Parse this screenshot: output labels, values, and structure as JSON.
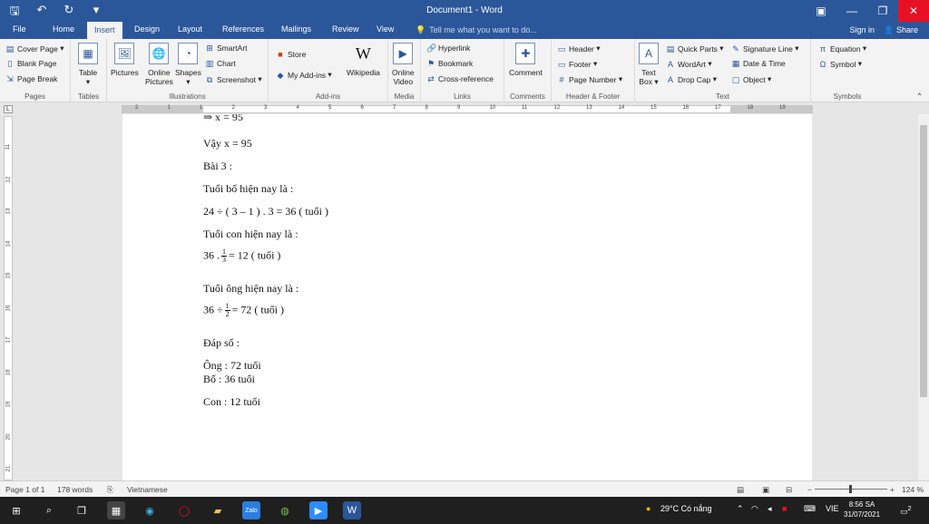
{
  "window": {
    "title": "Document1 - Word"
  },
  "tabs": [
    {
      "label": "File"
    },
    {
      "label": "Home"
    },
    {
      "label": "Insert"
    },
    {
      "label": "Design"
    },
    {
      "label": "Layout"
    },
    {
      "label": "References"
    },
    {
      "label": "Mailings"
    },
    {
      "label": "Review"
    },
    {
      "label": "View"
    }
  ],
  "tell_me": "Tell me what you want to do...",
  "account": {
    "signin": "Sign in",
    "share": "Share"
  },
  "ribbon": {
    "pages": {
      "label": "Pages",
      "cover": "Cover Page",
      "blank": "Blank Page",
      "break": "Page Break"
    },
    "tables": {
      "label": "Tables",
      "table": "Table"
    },
    "illustrations": {
      "label": "Illustrations",
      "pictures": "Pictures",
      "online1": "Online",
      "online2": "Pictures",
      "shapes": "Shapes",
      "smartart": "SmartArt",
      "chart": "Chart",
      "screenshot": "Screenshot"
    },
    "addins": {
      "label": "Add-ins",
      "store": "Store",
      "myaddins": "My Add-ins",
      "wikipedia": "Wikipedia"
    },
    "media": {
      "label": "Media",
      "video1": "Online",
      "video2": "Video"
    },
    "links": {
      "label": "Links",
      "hyperlink": "Hyperlink",
      "bookmark": "Bookmark",
      "crossref": "Cross-reference"
    },
    "comments": {
      "label": "Comments",
      "comment": "Comment"
    },
    "headerfooter": {
      "label": "Header & Footer",
      "header": "Header",
      "footer": "Footer",
      "pagenumber": "Page Number"
    },
    "text": {
      "label": "Text",
      "textbox1": "Text",
      "textbox2": "Box",
      "quickparts": "Quick Parts",
      "wordart": "WordArt",
      "dropcap": "Drop Cap",
      "signature": "Signature Line",
      "datetime": "Date & Time",
      "object": "Object"
    },
    "symbols": {
      "label": "Symbols",
      "equation": "Equation",
      "symbol": "Symbol"
    }
  },
  "document": {
    "lines": {
      "l0": "⇒ x = 95",
      "l1": "Vậy x = 95",
      "l2": "Bài 3 :",
      "l3": "Tuổi bố hiện nay là :",
      "l4": "24 ÷ ( 3 – 1 ) . 3 = 36 ( tuổi )",
      "l5": "Tuổi con hiện nay là :",
      "l6a": "36 .",
      "l6n": "1",
      "l6d": "3",
      "l6b": "= 12 ( tuổi )",
      "l7": "Tuổi ông hiện nay là :",
      "l8a": "36 ÷",
      "l8n": "1",
      "l8d": "2",
      "l8b": "= 72 ( tuổi )",
      "l9": "Đáp số :",
      "l10": "Ông : 72 tuổi",
      "l11": "Bố : 36 tuổi",
      "l12": "Con : 12 tuổi"
    }
  },
  "ruler_numbers": [
    "2",
    "1",
    "1",
    "2",
    "3",
    "4",
    "5",
    "6",
    "7",
    "8",
    "9",
    "10",
    "11",
    "12",
    "13",
    "14",
    "15",
    "16",
    "17",
    "18",
    "19"
  ],
  "vruler_numbers": [
    "11",
    "12",
    "13",
    "14",
    "15",
    "16",
    "17",
    "18",
    "19",
    "20",
    "21"
  ],
  "status": {
    "page": "Page 1 of 1",
    "words": "178 words",
    "language": "Vietnamese",
    "zoom": "124 %"
  },
  "taskbar": {
    "weather": "29°C  Có nắng",
    "lang": "VIE",
    "time": "8:56 SA",
    "date": "31/07/2021",
    "notif": "2"
  }
}
